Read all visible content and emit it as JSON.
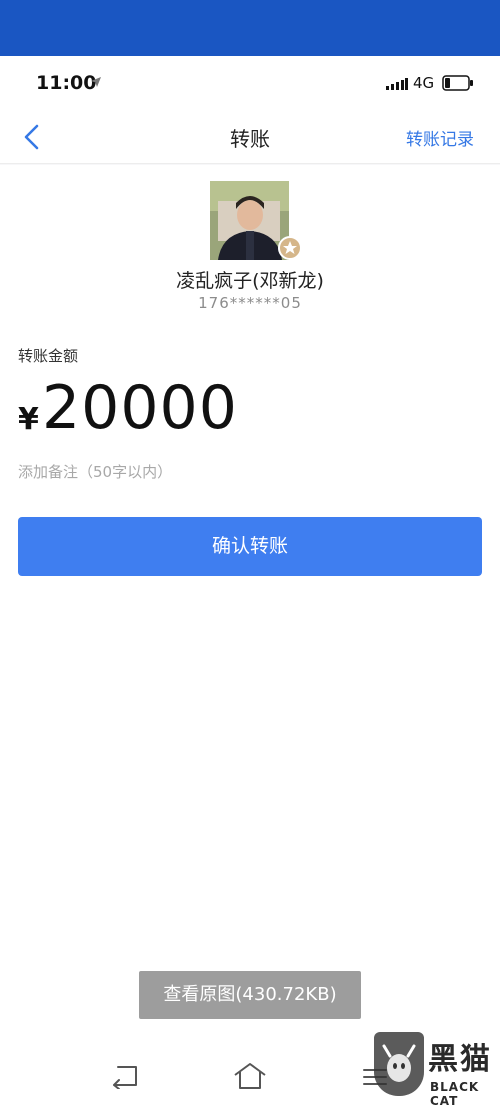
{
  "status_bar": {
    "time": "11:00",
    "network": "4G"
  },
  "nav": {
    "title": "转账",
    "right_link": "转账记录"
  },
  "recipient": {
    "name": "凌乱疯子(邓新龙)",
    "phone": "176******05"
  },
  "transfer": {
    "amount_label": "转账金额",
    "currency_symbol": "¥",
    "amount": "20000",
    "note_placeholder": "添加备注（50字以内）",
    "confirm_label": "确认转账"
  },
  "image_viewer": {
    "view_original_label": "查看原图(430.72KB)"
  },
  "watermark": {
    "brand_cn": "黑猫",
    "brand_en": "BLACK CAT"
  },
  "colors": {
    "top_band": "#1a56c2",
    "accent_link": "#3578e5",
    "primary_button": "#3f7ef0"
  }
}
